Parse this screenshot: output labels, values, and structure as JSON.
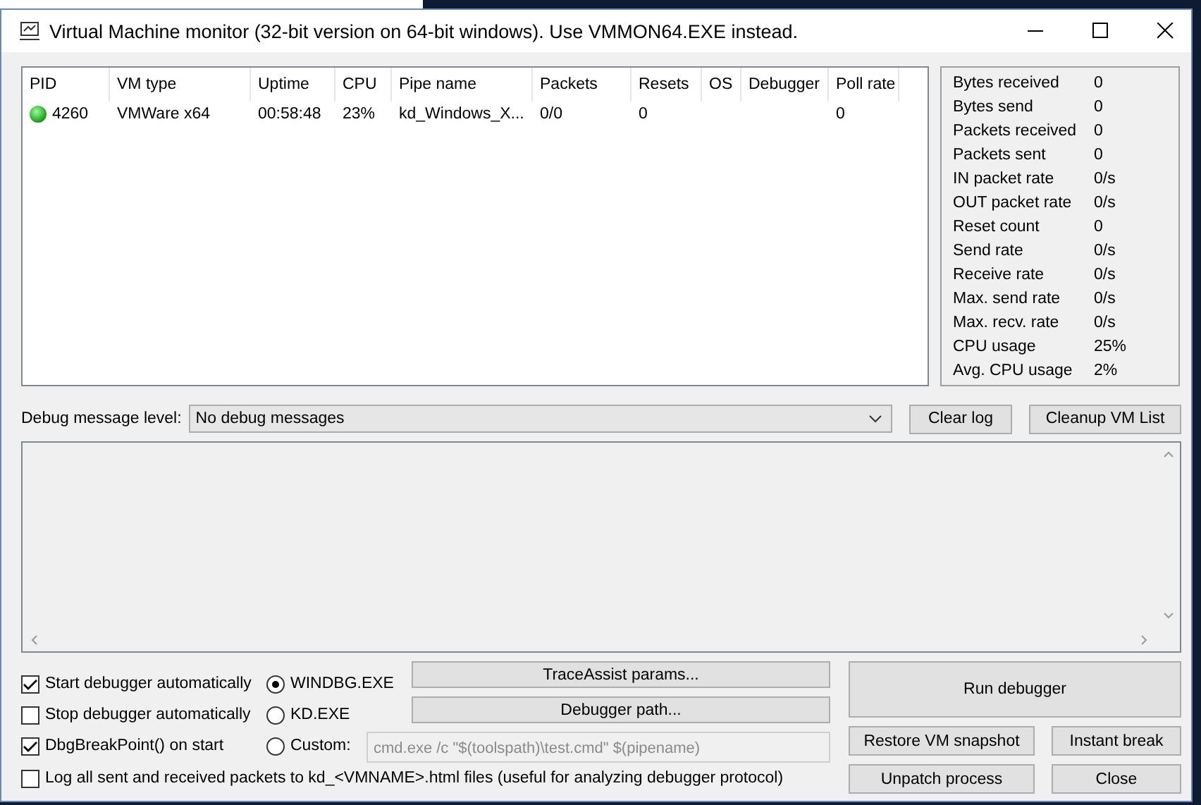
{
  "window": {
    "title": "Virtual Machine monitor (32-bit version on 64-bit windows). Use VMMON64.EXE instead."
  },
  "vm_list": {
    "columns": [
      "PID",
      "VM type",
      "Uptime",
      "CPU",
      "Pipe name",
      "Packets",
      "Resets",
      "OS",
      "Debugger",
      "Poll rate"
    ],
    "rows": [
      {
        "active": true,
        "cells": [
          "4260",
          "VMWare x64",
          "00:58:48",
          "23%",
          "kd_Windows_X...",
          "0/0",
          "0",
          "",
          "",
          "0"
        ]
      }
    ]
  },
  "stats": [
    {
      "label": "Bytes received",
      "value": "0"
    },
    {
      "label": "Bytes send",
      "value": "0"
    },
    {
      "label": "Packets received",
      "value": "0"
    },
    {
      "label": "Packets sent",
      "value": "0"
    },
    {
      "label": "IN packet rate",
      "value": "0/s"
    },
    {
      "label": "OUT packet rate",
      "value": "0/s"
    },
    {
      "label": "Reset count",
      "value": "0"
    },
    {
      "label": "Send rate",
      "value": "0/s"
    },
    {
      "label": "Receive rate",
      "value": "0/s"
    },
    {
      "label": "Max. send rate",
      "value": "0/s"
    },
    {
      "label": "Max. recv. rate",
      "value": "0/s"
    },
    {
      "label": "CPU usage",
      "value": "25%"
    },
    {
      "label": "Avg. CPU usage",
      "value": "2%"
    }
  ],
  "debug_level": {
    "label": "Debug message level:",
    "value": "No debug messages",
    "buttons": [
      "Clear log",
      "Cleanup VM List"
    ]
  },
  "options": [
    {
      "label": "Start debugger automatically",
      "checked": true
    },
    {
      "label": "Stop debugger automatically",
      "checked": false
    },
    {
      "label": "DbgBreakPoint() on start",
      "checked": true
    }
  ],
  "debuggers": [
    {
      "label": "WINDBG.EXE",
      "selected": true
    },
    {
      "label": "KD.EXE",
      "selected": false
    },
    {
      "label": "Custom:",
      "selected": false
    }
  ],
  "custom_command": {
    "value": "cmd.exe /c \"$(toolspath)\\test.cmd\" $(pipename)",
    "disabled": true
  },
  "tool_buttons": [
    "TraceAssist params...",
    "Debugger path..."
  ],
  "log_packets": {
    "label": "Log all sent and received packets to kd_<VMNAME>.html files (useful for analyzing debugger protocol)",
    "checked": false
  },
  "action_buttons": {
    "primary": "Run debugger",
    "secondary": [
      "Restore VM snapshot",
      "Instant break",
      "Unpatch process",
      "Close"
    ]
  }
}
